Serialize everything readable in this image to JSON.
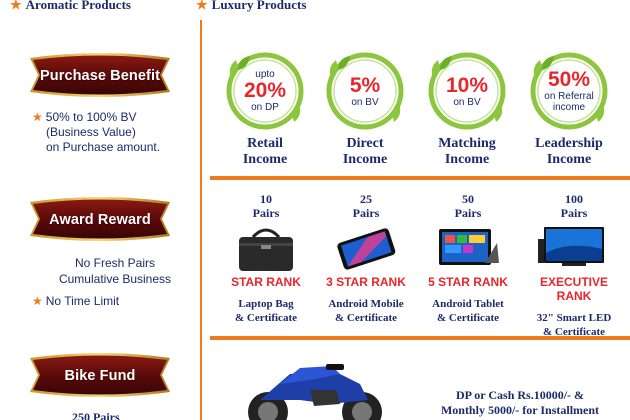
{
  "top_items": [
    {
      "label": "Aromatic Products"
    },
    {
      "label": "Luxury Products"
    }
  ],
  "sections": {
    "purchase": {
      "title": "Purchase Benefit",
      "bullet": "50% to 100% BV",
      "lines": [
        "(Business Value)",
        "on Purchase amount."
      ]
    },
    "award": {
      "title": "Award Reward",
      "lines": [
        "No Fresh Pairs",
        "Cumulative Business"
      ],
      "bullet": "No Time Limit"
    },
    "bike": {
      "title": "Bike Fund",
      "pairs_partial": "250 Pairs",
      "offer_lines": [
        "DP or Cash Rs.10000/- &",
        "Monthly 5000/- for Installment"
      ]
    }
  },
  "incomes": [
    {
      "top": "upto",
      "pct": "20%",
      "bottom": "on DP",
      "label1": "Retail",
      "label2": "Income"
    },
    {
      "top": "",
      "pct": "5%",
      "bottom": "on BV",
      "label1": "Direct",
      "label2": "Income"
    },
    {
      "top": "",
      "pct": "10%",
      "bottom": "on BV",
      "label1": "Matching",
      "label2": "Income"
    },
    {
      "top": "",
      "pct": "50%",
      "bottom": "on Referral income",
      "label1": "Leadership",
      "label2": "Income"
    }
  ],
  "awards": [
    {
      "pairs": "10",
      "pairs_word": "Pairs",
      "icon": "laptop-bag-icon",
      "rank": "STAR RANK",
      "desc1": "Laptop Bag",
      "desc2": "& Certificate"
    },
    {
      "pairs": "25",
      "pairs_word": "Pairs",
      "icon": "android-mobile-icon",
      "rank": "3 STAR RANK",
      "desc1": "Android Mobile",
      "desc2": "& Certificate"
    },
    {
      "pairs": "50",
      "pairs_word": "Pairs",
      "icon": "android-tablet-icon",
      "rank": "5 STAR RANK",
      "desc1": "Android Tablet",
      "desc2": "& Certificate"
    },
    {
      "pairs": "100",
      "pairs_word": "Pairs",
      "icon": "smart-led-tv-icon",
      "rank": "EXECUTIVE RANK",
      "desc1": "32\" Smart LED",
      "desc2": "& Certificate"
    }
  ],
  "colors": {
    "accent_orange": "#f07b1a",
    "text_navy": "#1c2a6b",
    "rank_red": "#e8262b",
    "ribbon_maroon": "#5a0a0a",
    "leaf_green": "#8cc63f"
  }
}
